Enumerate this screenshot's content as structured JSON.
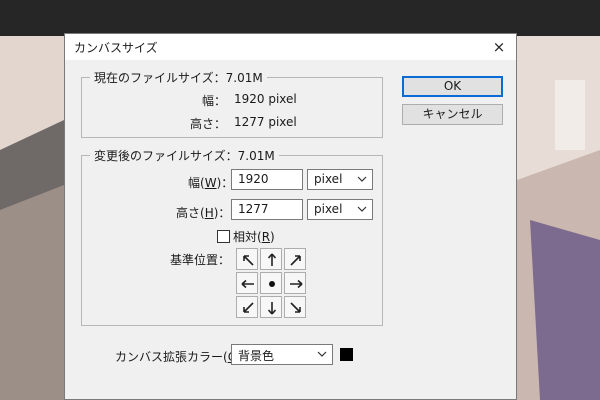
{
  "dialog": {
    "title": "カンバスサイズ",
    "close_glyph": "×"
  },
  "current_size": {
    "legend": "現在のファイルサイズ：7.01M",
    "width_label": "幅：",
    "width_value": "1920 pixel",
    "height_label": "高さ：",
    "height_value": "1277 pixel"
  },
  "new_size": {
    "legend": "変更後のファイルサイズ：7.01M",
    "width_label_prefix": "幅(",
    "width_label_key": "W",
    "width_label_suffix": ")：",
    "width_value": "1920",
    "width_unit": "pixel",
    "height_label_prefix": "高さ(",
    "height_label_key": "H",
    "height_label_suffix": ")：",
    "height_value": "1277",
    "height_unit": "pixel",
    "relative_prefix": "相対(",
    "relative_key": "R",
    "relative_suffix": ")",
    "relative_checked": false,
    "anchor_label": "基準位置：",
    "anchor_selected": "center"
  },
  "extension": {
    "label_prefix": "カンバス拡張カラー(",
    "label_key": "C",
    "label_suffix": ")：",
    "value": "背景色",
    "swatch_color": "#000000"
  },
  "buttons": {
    "ok": "OK",
    "cancel": "キャンセル"
  }
}
